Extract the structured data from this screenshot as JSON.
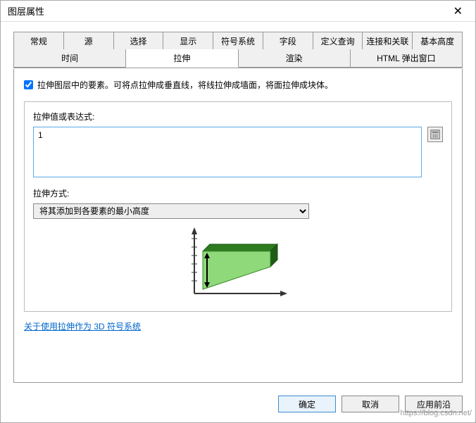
{
  "window": {
    "title": "图层属性"
  },
  "tabs_row1": [
    {
      "label": "常规"
    },
    {
      "label": "源"
    },
    {
      "label": "选择"
    },
    {
      "label": "显示"
    },
    {
      "label": "符号系统"
    },
    {
      "label": "字段"
    },
    {
      "label": "定义查询"
    },
    {
      "label": "连接和关联"
    },
    {
      "label": "基本高度"
    }
  ],
  "tabs_row2": [
    {
      "label": "时间"
    },
    {
      "label": "拉伸"
    },
    {
      "label": "渲染"
    },
    {
      "label": "HTML 弹出窗口"
    }
  ],
  "checkbox": {
    "text": "拉伸图层中的要素。可将点拉伸成垂直线，将线拉伸成墙面，将面拉伸成块体。"
  },
  "expression": {
    "label": "拉伸值或表达式:",
    "value": "1"
  },
  "method": {
    "label": "拉伸方式:",
    "selected": "将其添加到各要素的最小高度"
  },
  "help_link": "关于使用拉伸作为 3D 符号系统",
  "buttons": {
    "ok": "确定",
    "cancel": "取消",
    "apply": "应用前沿"
  },
  "watermark": "https://blog.csdn.net/"
}
